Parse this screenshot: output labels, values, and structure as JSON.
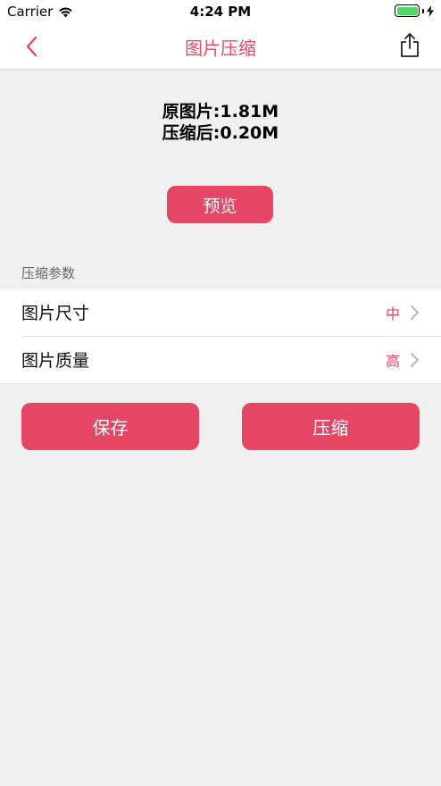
{
  "status_bar": {
    "carrier": "Carrier",
    "time": "4:24 PM",
    "battery_level": 1.0,
    "battery_color": "#4cd964"
  },
  "nav": {
    "title": "图片压缩",
    "back_icon": "chevron-left-icon",
    "share_icon": "share-icon"
  },
  "info": {
    "original": "原图片:1.81M",
    "compressed": "压缩后:0.20M"
  },
  "preview_label": "预览",
  "section_label": "压缩参数",
  "settings": [
    {
      "label": "图片尺寸",
      "value": "中"
    },
    {
      "label": "图片质量",
      "value": "高"
    }
  ],
  "actions": {
    "save_label": "保存",
    "compress_label": "压缩"
  },
  "colors": {
    "accent": "#e44663",
    "title": "#e94a62",
    "background": "#f0f0f0"
  }
}
